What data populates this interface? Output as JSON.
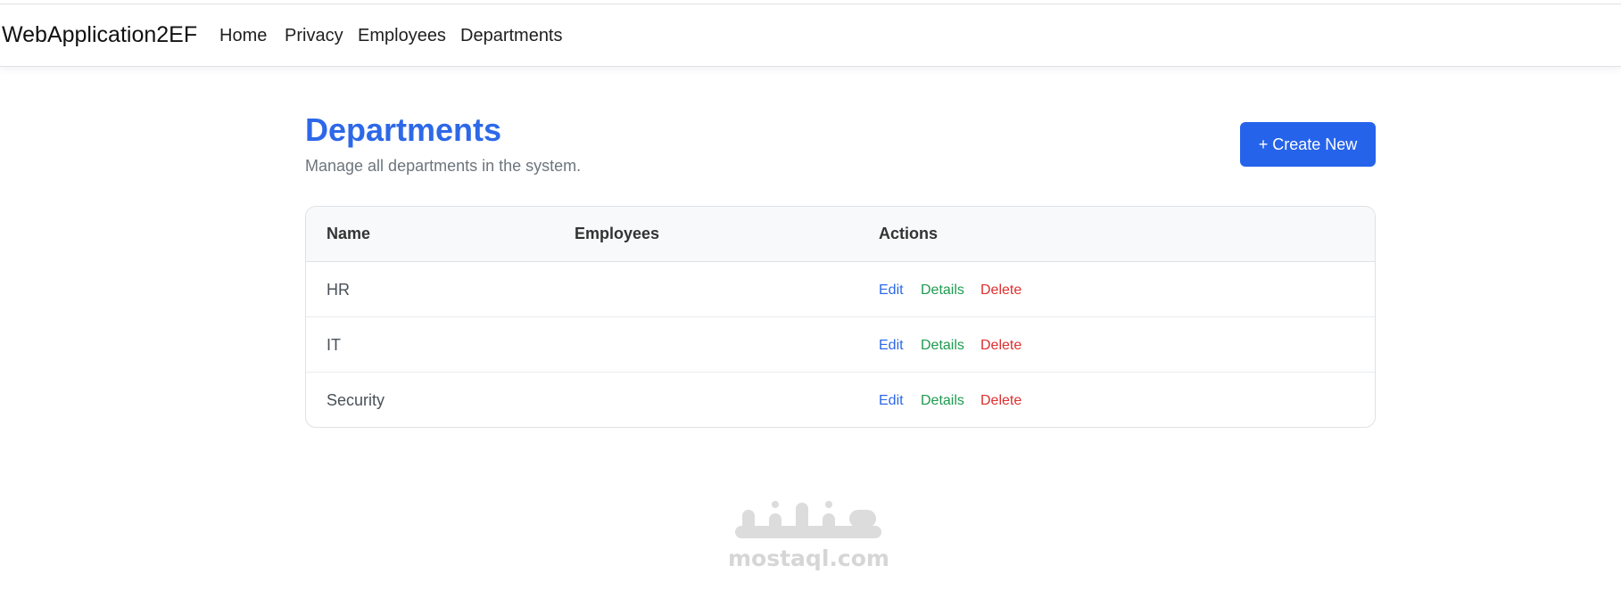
{
  "navbar": {
    "brand": "WebApplication2EF",
    "links": [
      {
        "label": "Home"
      },
      {
        "label": "Privacy"
      },
      {
        "label": "Employees"
      },
      {
        "label": "Departments"
      }
    ]
  },
  "page": {
    "title": "Departments",
    "subtitle": "Manage all departments in the system.",
    "create_button_label": "+ Create New"
  },
  "table": {
    "headers": [
      "Name",
      "Employees",
      "Actions"
    ],
    "rows": [
      {
        "name": "HR",
        "employees": "",
        "actions": [
          "Edit",
          "Details",
          "Delete"
        ]
      },
      {
        "name": "IT",
        "employees": "",
        "actions": [
          "Edit",
          "Details",
          "Delete"
        ]
      },
      {
        "name": "Security",
        "employees": "",
        "actions": [
          "Edit",
          "Details",
          "Delete"
        ]
      }
    ]
  },
  "watermark": {
    "arabic_text": "مستقل",
    "text": "mostaql.com"
  },
  "colors": {
    "accent": "#2563eb",
    "title": "#2d68e8",
    "edit": "#2d68e8",
    "details": "#1e9a4f",
    "delete": "#dc2f2f"
  }
}
